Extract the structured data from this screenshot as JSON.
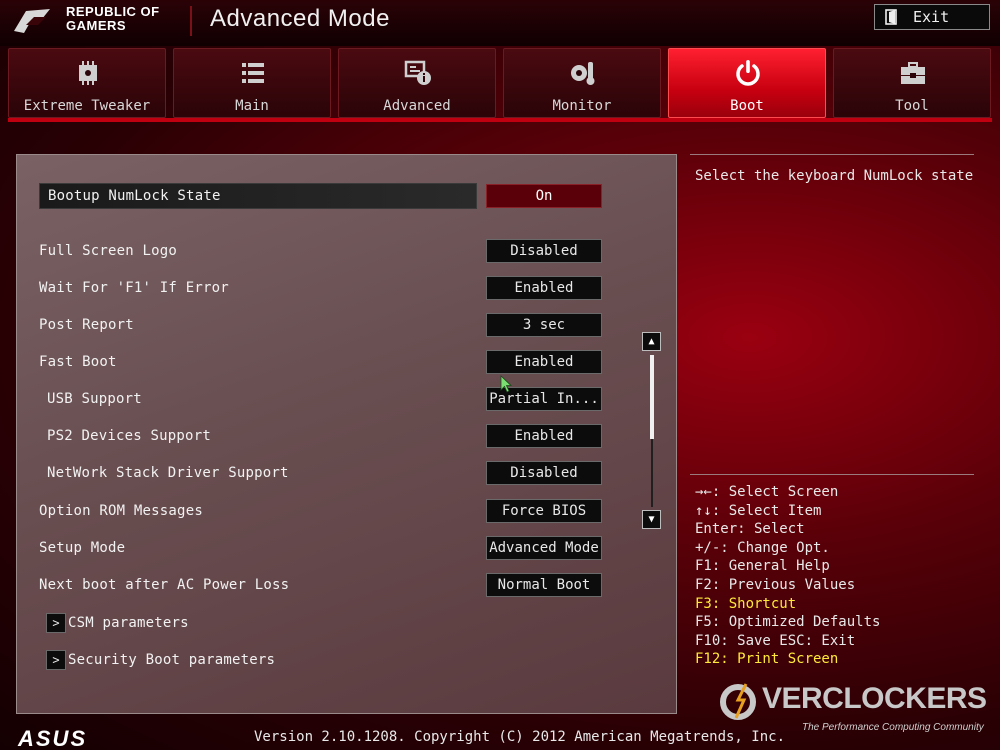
{
  "header": {
    "brand_line1": "REPUBLIC OF",
    "brand_line2": "GAMERS",
    "mode_title": "Advanced Mode",
    "exit_label": "Exit"
  },
  "tabs": [
    {
      "label": "Extreme Tweaker",
      "icon": "tweaker-icon",
      "active": false
    },
    {
      "label": "Main",
      "icon": "list-icon",
      "active": false
    },
    {
      "label": "Advanced",
      "icon": "advanced-icon",
      "active": false
    },
    {
      "label": "Monitor",
      "icon": "monitor-icon",
      "active": false
    },
    {
      "label": "Boot",
      "icon": "power-icon",
      "active": true
    },
    {
      "label": "Tool",
      "icon": "toolbox-icon",
      "active": false
    }
  ],
  "settings": [
    {
      "label": "Bootup NumLock State",
      "value": "On",
      "selected": true
    },
    {
      "label": "Full Screen Logo",
      "value": "Disabled"
    },
    {
      "label": "Wait For 'F1' If Error",
      "value": "Enabled"
    },
    {
      "label": "Post Report",
      "value": "3 sec"
    },
    {
      "label": "Fast Boot",
      "value": "Enabled"
    },
    {
      "label": "USB Support",
      "value": "Partial In..."
    },
    {
      "label": "PS2 Devices Support",
      "value": "Enabled"
    },
    {
      "label": "NetWork Stack Driver Support",
      "value": "Disabled"
    },
    {
      "label": "Option ROM Messages",
      "value": "Force BIOS"
    },
    {
      "label": "Setup Mode",
      "value": "Advanced Mode"
    },
    {
      "label": "Next boot after AC Power Loss",
      "value": "Normal Boot"
    }
  ],
  "submenus": [
    {
      "label": "CSM parameters"
    },
    {
      "label": "Security Boot parameters"
    }
  ],
  "help": {
    "description": "Select the keyboard NumLock state"
  },
  "keys": [
    {
      "text": "→←: Select Screen",
      "highlight": false
    },
    {
      "text": "↑↓: Select Item",
      "highlight": false
    },
    {
      "text": "Enter: Select",
      "highlight": false
    },
    {
      "text": "+/-: Change Opt.",
      "highlight": false
    },
    {
      "text": "F1: General Help",
      "highlight": false
    },
    {
      "text": "F2: Previous Values",
      "highlight": false
    },
    {
      "text": "F3: Shortcut",
      "highlight": true
    },
    {
      "text": "F5: Optimized Defaults",
      "highlight": false
    },
    {
      "text": "F10: Save  ESC: Exit",
      "highlight": false
    },
    {
      "text": "F12: Print Screen",
      "highlight": true
    }
  ],
  "footer": {
    "brand": "ASUS",
    "version": "Version 2.10.1208. Copyright (C) 2012 American Megatrends, Inc."
  },
  "watermark": {
    "name": "VERCLOCKERS",
    "tagline": "The Performance Computing Community"
  },
  "colors": {
    "accent": "#c80010",
    "highlight_key": "#ffea3a"
  }
}
